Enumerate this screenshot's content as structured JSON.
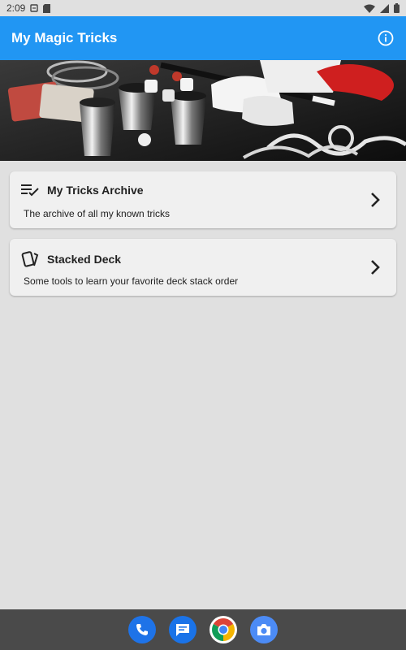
{
  "status_bar": {
    "time": "2:09",
    "icons": [
      "wifi-icon",
      "signal-icon",
      "battery-icon"
    ]
  },
  "app_bar": {
    "title": "My Magic Tricks",
    "info_icon": "info-icon",
    "color": "#2196f3"
  },
  "cards": [
    {
      "icon": "checklist-icon",
      "title": "My Tricks Archive",
      "subtitle": "The archive of all my known tricks"
    },
    {
      "icon": "cards-icon",
      "title": "Stacked Deck",
      "subtitle": "Some tools to learn your favorite deck stack order"
    }
  ],
  "dock": [
    "phone-icon",
    "messages-icon",
    "chrome-icon",
    "camera-icon"
  ]
}
